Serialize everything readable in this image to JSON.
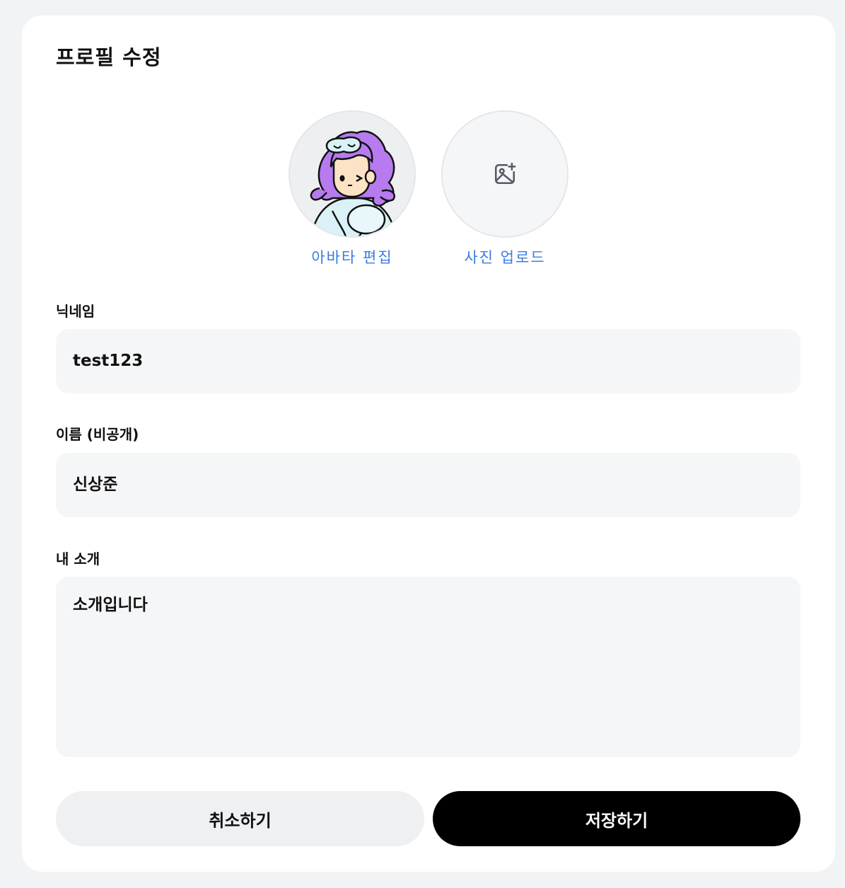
{
  "page": {
    "title": "프로필 수정"
  },
  "avatar": {
    "edit_label": "아바타 편집",
    "upload_label": "사진 업로드",
    "upload_icon": "image-plus-icon"
  },
  "fields": {
    "nickname": {
      "label": "닉네임",
      "value": "test123"
    },
    "name": {
      "label": "이름 (비공개)",
      "value": "신상준"
    },
    "bio": {
      "label": "내 소개",
      "value": "소개입니다"
    }
  },
  "actions": {
    "cancel_label": "취소하기",
    "save_label": "저장하기"
  },
  "colors": {
    "accent_link": "#3b7be0",
    "primary_button": "#000000",
    "secondary_button": "#eff0f2",
    "input_bg": "#f5f6f8",
    "page_bg": "#f2f3f5"
  }
}
